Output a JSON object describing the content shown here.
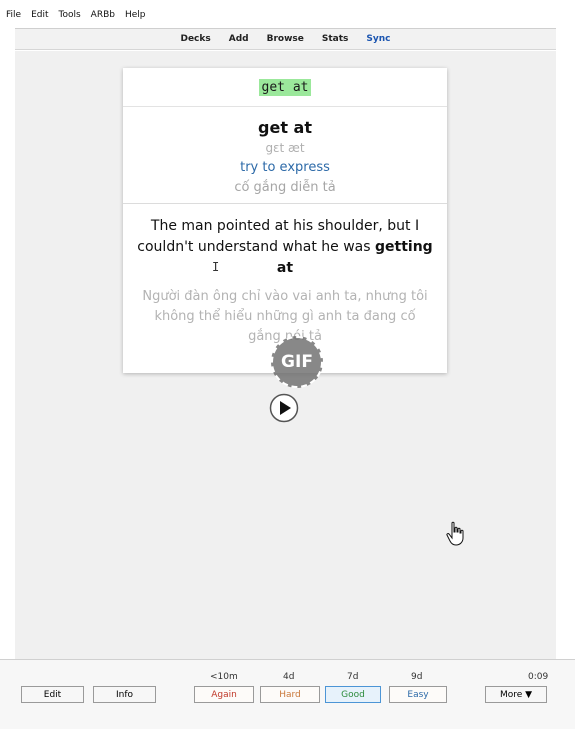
{
  "menu": {
    "file": "File",
    "edit": "Edit",
    "tools": "Tools",
    "arbb": "ARBb",
    "help": "Help"
  },
  "toolbar": {
    "decks": "Decks",
    "add": "Add",
    "browse": "Browse",
    "stats": "Stats",
    "sync": "Sync"
  },
  "card": {
    "front": "get at",
    "word": "get at",
    "ipa": "gɛt æt",
    "meaning": "try to express",
    "meaning_vi": "cố gắng diễn tả",
    "example_part1": "The man pointed at his shoulder, but I couldn't understand what he was ",
    "example_bold": "getting at",
    "example_vi": "Người đàn ông chỉ vào vai anh ta, nhưng tôi không thể hiểu những gì anh ta đang cố gắng nói tả",
    "gif_label": "GIF"
  },
  "bottom": {
    "edit": "Edit",
    "info": "Info",
    "again_interval": "<10m",
    "hard_interval": "4d",
    "good_interval": "7d",
    "easy_interval": "9d",
    "again": "Again",
    "hard": "Hard",
    "good": "Good",
    "easy": "Easy",
    "more": "More ▼",
    "timer": "0:09"
  },
  "icons": {
    "play": "play-icon",
    "gif": "gif-icon",
    "cursor": "hand-cursor-icon",
    "ibeam": "text-cursor-icon"
  }
}
